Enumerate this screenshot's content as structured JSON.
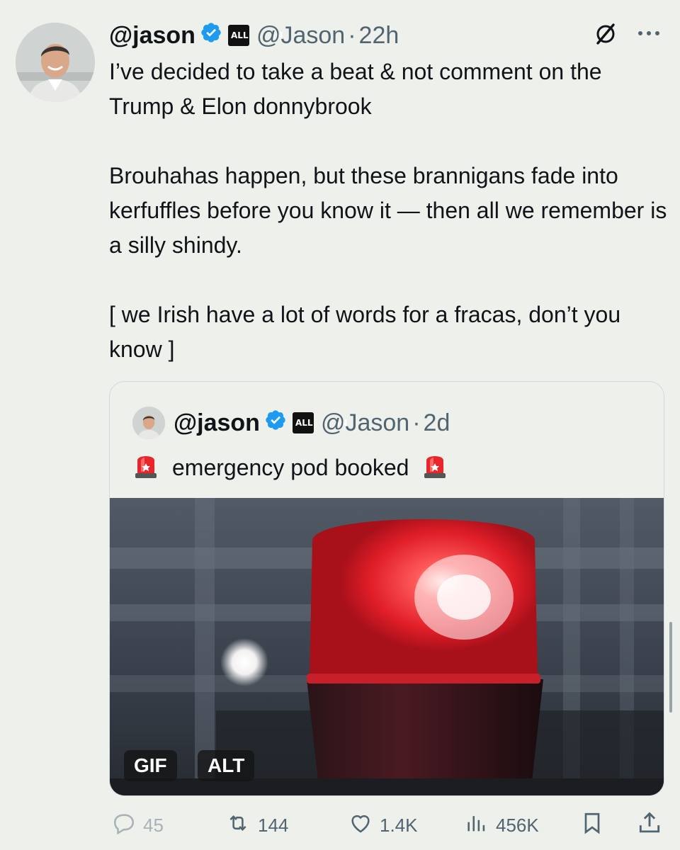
{
  "tweet": {
    "display_name": "@jason",
    "affiliate_badge": "ALL IN",
    "handle": "@Jason",
    "separator": "·",
    "time": "22h",
    "paragraphs": [
      "I’ve decided to take a beat & not comment on the Trump & Elon donnybrook",
      "Brouhahas happen, but these brannigans fade into kerfuffles before you know it — then all we remember is a silly shindy.",
      "[ we Irish have a lot of words for a fracas, don’t you know ]"
    ]
  },
  "quoted_tweet": {
    "display_name": "@jason",
    "affiliate_badge": "ALL IN",
    "handle": "@Jason",
    "separator": "·",
    "time": "2d",
    "text": "emergency pod booked",
    "media_badges": {
      "gif": "GIF",
      "alt": "ALT"
    }
  },
  "actions": {
    "replies": "45",
    "reposts": "144",
    "likes": "1.4K",
    "views": "456K"
  },
  "icons": {
    "verified": "verified-badge-icon",
    "grok": "grok-icon",
    "more": "more-icon",
    "siren": "police-siren-emoji",
    "reply": "reply-icon",
    "repost": "repost-icon",
    "like": "heart-icon",
    "views": "views-icon",
    "bookmark": "bookmark-icon",
    "share": "share-icon"
  },
  "colors": {
    "background": "#eef0eb",
    "text": "#0f1419",
    "secondary": "#536471",
    "verified_blue": "#1d9bf0",
    "siren_red": "#ff2a2a"
  }
}
